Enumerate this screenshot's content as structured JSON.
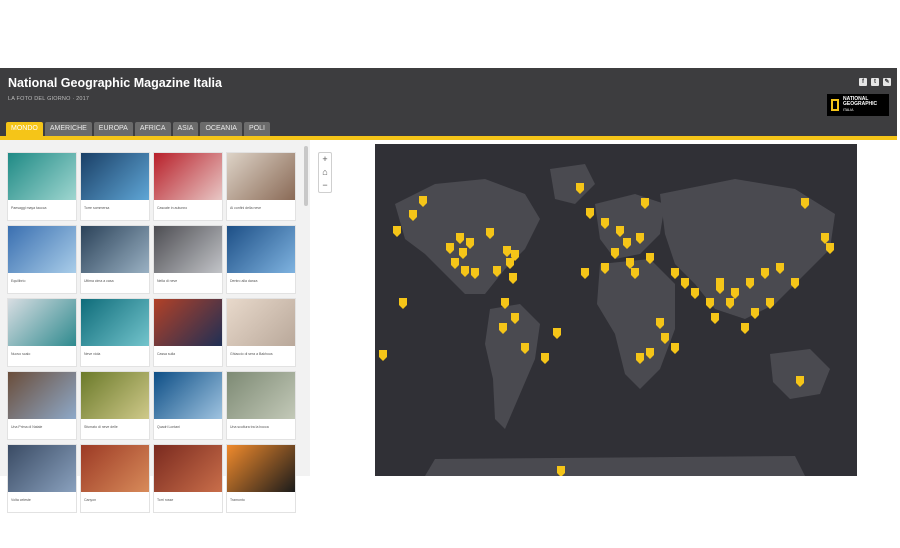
{
  "header": {
    "title": "National Geographic Magazine Italia",
    "subtitle": "LA FOTO DEL GIORNO · 2017",
    "social": [
      "f",
      "t",
      "✎"
    ],
    "logo_text": "NATIONAL GEOGRAPHIC",
    "logo_sub": "ITALIA"
  },
  "tabs": [
    "MONDO",
    "AMERICHE",
    "EUROPA",
    "AFRICA",
    "ASIA",
    "OCEANIA",
    "POLI"
  ],
  "active_tab": "MONDO",
  "accent_color": "#f5c518",
  "gallery": [
    {
      "caption": "Paesaggi maya taucca",
      "colors": [
        "#1f8a85",
        "#9fd6d0"
      ]
    },
    {
      "caption": "Torre sommersa",
      "colors": [
        "#1a3f66",
        "#5fa6d6"
      ]
    },
    {
      "caption": "Cascate in autunno",
      "colors": [
        "#b8202a",
        "#e8c7c5"
      ]
    },
    {
      "caption": "Ai confini della neve",
      "colors": [
        "#ddd3c7",
        "#8a6a56"
      ]
    },
    {
      "caption": "Equilibrio",
      "colors": [
        "#3a6fb0",
        "#a9cde9"
      ]
    },
    {
      "caption": "Ultima cima a casa",
      "colors": [
        "#2b4259",
        "#9ab1c3"
      ]
    },
    {
      "caption": "Nella di neve",
      "colors": [
        "#4d4d52",
        "#c2c4c8"
      ]
    },
    {
      "caption": "Dentro alla danza",
      "colors": [
        "#1d4f86",
        "#7fb3e0"
      ]
    },
    {
      "caption": "Nuovo scalo",
      "colors": [
        "#d8dde2",
        "#2e8a8e"
      ]
    },
    {
      "caption": "Neve viola",
      "colors": [
        "#0f6c7a",
        "#73c4cc"
      ]
    },
    {
      "caption": "Cassa sulla",
      "colors": [
        "#b24127",
        "#1f2f55"
      ]
    },
    {
      "caption": "Ghiaccio di sera a Bakhous",
      "colors": [
        "#e8d9cb",
        "#b9a89a"
      ]
    },
    {
      "caption": "Una Prima di Natale",
      "colors": [
        "#6a4d3a",
        "#8ea9c9"
      ]
    },
    {
      "caption": "Sfumato di neve delle",
      "colors": [
        "#6b7a2a",
        "#cfc98a"
      ]
    },
    {
      "caption": "Quadri Lontani",
      "colors": [
        "#0e4f86",
        "#9fc3e0"
      ]
    },
    {
      "caption": "Una scultura tra la bocca",
      "colors": [
        "#7d8a74",
        "#c3c9b8"
      ]
    },
    {
      "caption": "Volta celeste",
      "colors": [
        "#3a4b64",
        "#8aa1be"
      ]
    },
    {
      "caption": "Canyon",
      "colors": [
        "#9c3a25",
        "#d88b5a"
      ]
    },
    {
      "caption": "Torri rosse",
      "colors": [
        "#7a2a1f",
        "#c96e4a"
      ]
    },
    {
      "caption": "Tramonto",
      "colors": [
        "#f08a2c",
        "#1b1b1b"
      ]
    }
  ],
  "map_controls": {
    "zoom_in": "+",
    "home": "⌂",
    "zoom_out": "−"
  }
}
